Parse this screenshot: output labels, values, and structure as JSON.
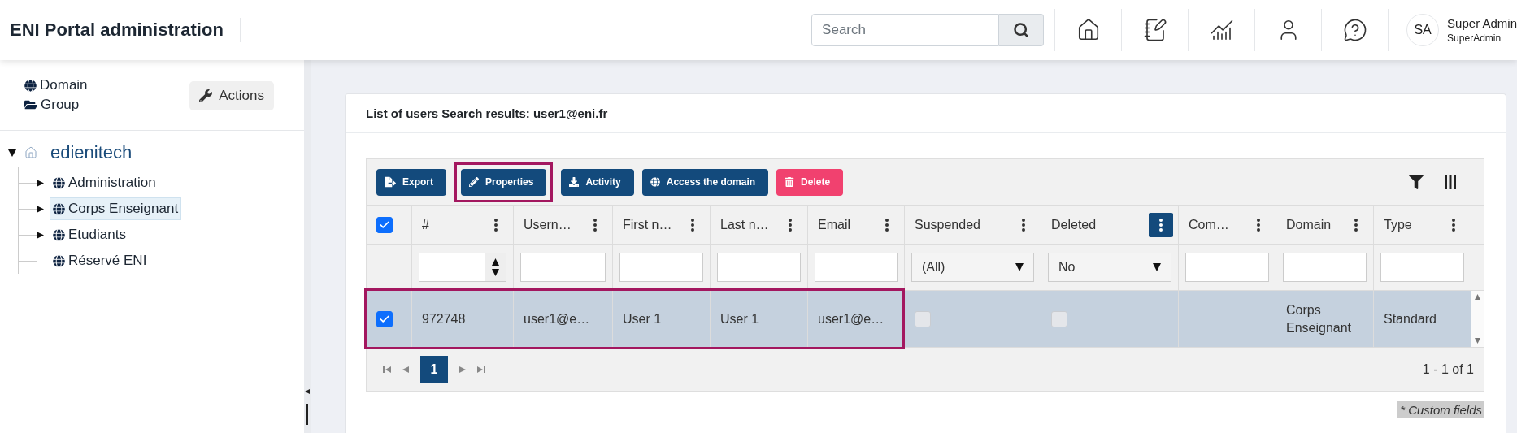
{
  "header": {
    "title": "ENI Portal administration",
    "search": {
      "placeholder": "Search"
    },
    "user": {
      "initials": "SA",
      "name": "Super Admin",
      "role": "SuperAdmin"
    }
  },
  "sidebar": {
    "links": [
      {
        "label": "Domain",
        "kind": "domain"
      },
      {
        "label": "Group",
        "kind": "group"
      }
    ],
    "actions_button": "Actions",
    "tree": {
      "label": "edienitech",
      "expanded": true,
      "children": [
        {
          "label": "Administration",
          "kind": "branch",
          "selected": false
        },
        {
          "label": "Corps Enseignant",
          "kind": "branch",
          "selected": true
        },
        {
          "label": "Etudiants",
          "kind": "branch",
          "selected": false
        },
        {
          "label": "Réservé ENI",
          "kind": "leaf",
          "selected": false
        }
      ]
    }
  },
  "panel": {
    "title": "List of users Search results: user1@eni.fr",
    "toolbar": [
      {
        "label": "Export",
        "kind": "export",
        "highlighted": false
      },
      {
        "label": "Properties",
        "kind": "edit",
        "highlighted": true
      },
      {
        "label": "Activity",
        "kind": "download",
        "highlighted": false
      },
      {
        "label": "Access the domain",
        "kind": "globe",
        "highlighted": false
      },
      {
        "label": "Delete",
        "kind": "delete",
        "highlighted": false
      }
    ],
    "grid": {
      "select_all_checked": true,
      "columns": [
        {
          "label": "#",
          "menu_active": false,
          "filter": {
            "kind": "number"
          }
        },
        {
          "label": "Usern…",
          "menu_active": false,
          "filter": {
            "kind": "text"
          }
        },
        {
          "label": "First n…",
          "menu_active": false,
          "filter": {
            "kind": "text"
          }
        },
        {
          "label": "Last n…",
          "menu_active": false,
          "filter": {
            "kind": "text"
          }
        },
        {
          "label": "Email",
          "menu_active": false,
          "filter": {
            "kind": "text"
          }
        },
        {
          "label": "Suspended",
          "menu_active": false,
          "filter": {
            "kind": "select",
            "value": "(All)"
          }
        },
        {
          "label": "Deleted",
          "menu_active": true,
          "filter": {
            "kind": "select",
            "value": "No"
          }
        },
        {
          "label": "Com…",
          "menu_active": false,
          "filter": {
            "kind": "text"
          }
        },
        {
          "label": "Domain",
          "menu_active": false,
          "filter": {
            "kind": "text"
          }
        },
        {
          "label": "Type",
          "menu_active": false,
          "filter": {
            "kind": "text"
          }
        }
      ],
      "rows": [
        {
          "selected": true,
          "highlighted": true,
          "cells": [
            {
              "kind": "text",
              "text": "972748"
            },
            {
              "kind": "text",
              "text": "user1@e…"
            },
            {
              "kind": "text",
              "text": "User 1"
            },
            {
              "kind": "text",
              "text": "User 1"
            },
            {
              "kind": "text",
              "text": "user1@e…"
            },
            {
              "kind": "checkbox",
              "checked": false
            },
            {
              "kind": "checkbox",
              "checked": false
            },
            {
              "kind": "empty"
            },
            {
              "kind": "text",
              "text": "Corps Enseignant"
            },
            {
              "kind": "text",
              "text": "Standard"
            }
          ]
        }
      ],
      "pager": {
        "pages": [
          {
            "label": "1",
            "selected": true
          }
        ],
        "summary": "1 - 1 of 1"
      }
    },
    "footnote": "* Custom fields"
  }
}
